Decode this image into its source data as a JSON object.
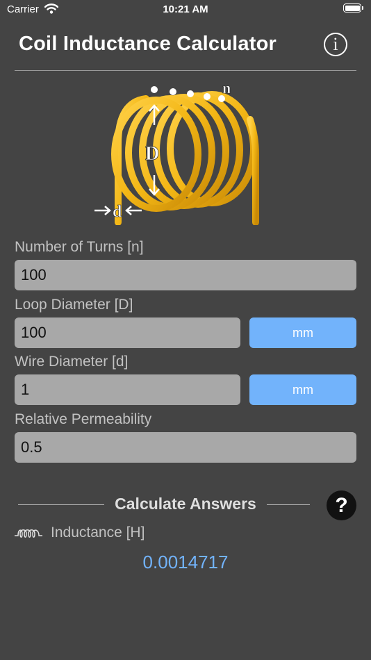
{
  "status_bar": {
    "carrier": "Carrier",
    "time": "10:21 AM"
  },
  "header": {
    "title": "Coil Inductance Calculator",
    "info_glyph": "i"
  },
  "diagram": {
    "turns_label": "n",
    "loop_diameter_label": "D",
    "wire_diameter_label": "d",
    "wire_color": "#f3b716"
  },
  "fields": {
    "turns": {
      "label": "Number of Turns [n]",
      "value": "100"
    },
    "loop_diameter": {
      "label": "Loop Diameter [D]",
      "value": "100",
      "unit": "mm"
    },
    "wire_diameter": {
      "label": "Wire Diameter [d]",
      "value": "1",
      "unit": "mm"
    },
    "permeability": {
      "label": "Relative Permeability",
      "value": "0.5"
    }
  },
  "answers": {
    "section_title": "Calculate Answers",
    "help_glyph": "?",
    "inductance_label": "Inductance [H]",
    "inductance_value": "0.0014717"
  },
  "colors": {
    "background": "#444444",
    "accent": "#72b3fb",
    "field": "#a8a8a8"
  }
}
